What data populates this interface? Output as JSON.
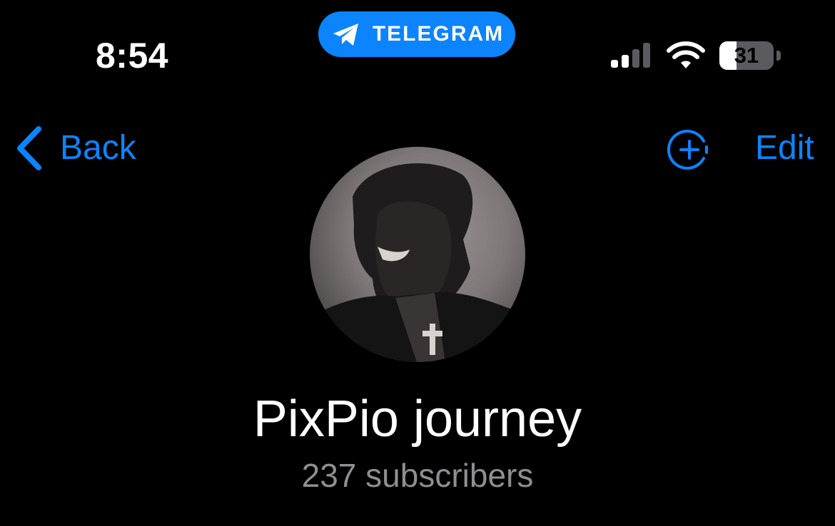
{
  "status_bar": {
    "time": "8:54",
    "active_app": "TELEGRAM",
    "battery_level": "31",
    "battery_fraction": 0.31
  },
  "nav": {
    "back_label": "Back",
    "edit_label": "Edit"
  },
  "profile": {
    "name": "PixPio journey",
    "subscribers": "237 subscribers"
  },
  "colors": {
    "accent": "#0b84fe",
    "background": "#000000",
    "secondary_text": "#8e8e93"
  },
  "icons": {
    "back": "chevron-left-icon",
    "add_story": "add-story-icon",
    "app": "telegram-icon",
    "signal": "signal-icon",
    "wifi": "wifi-icon",
    "battery": "battery-icon"
  }
}
